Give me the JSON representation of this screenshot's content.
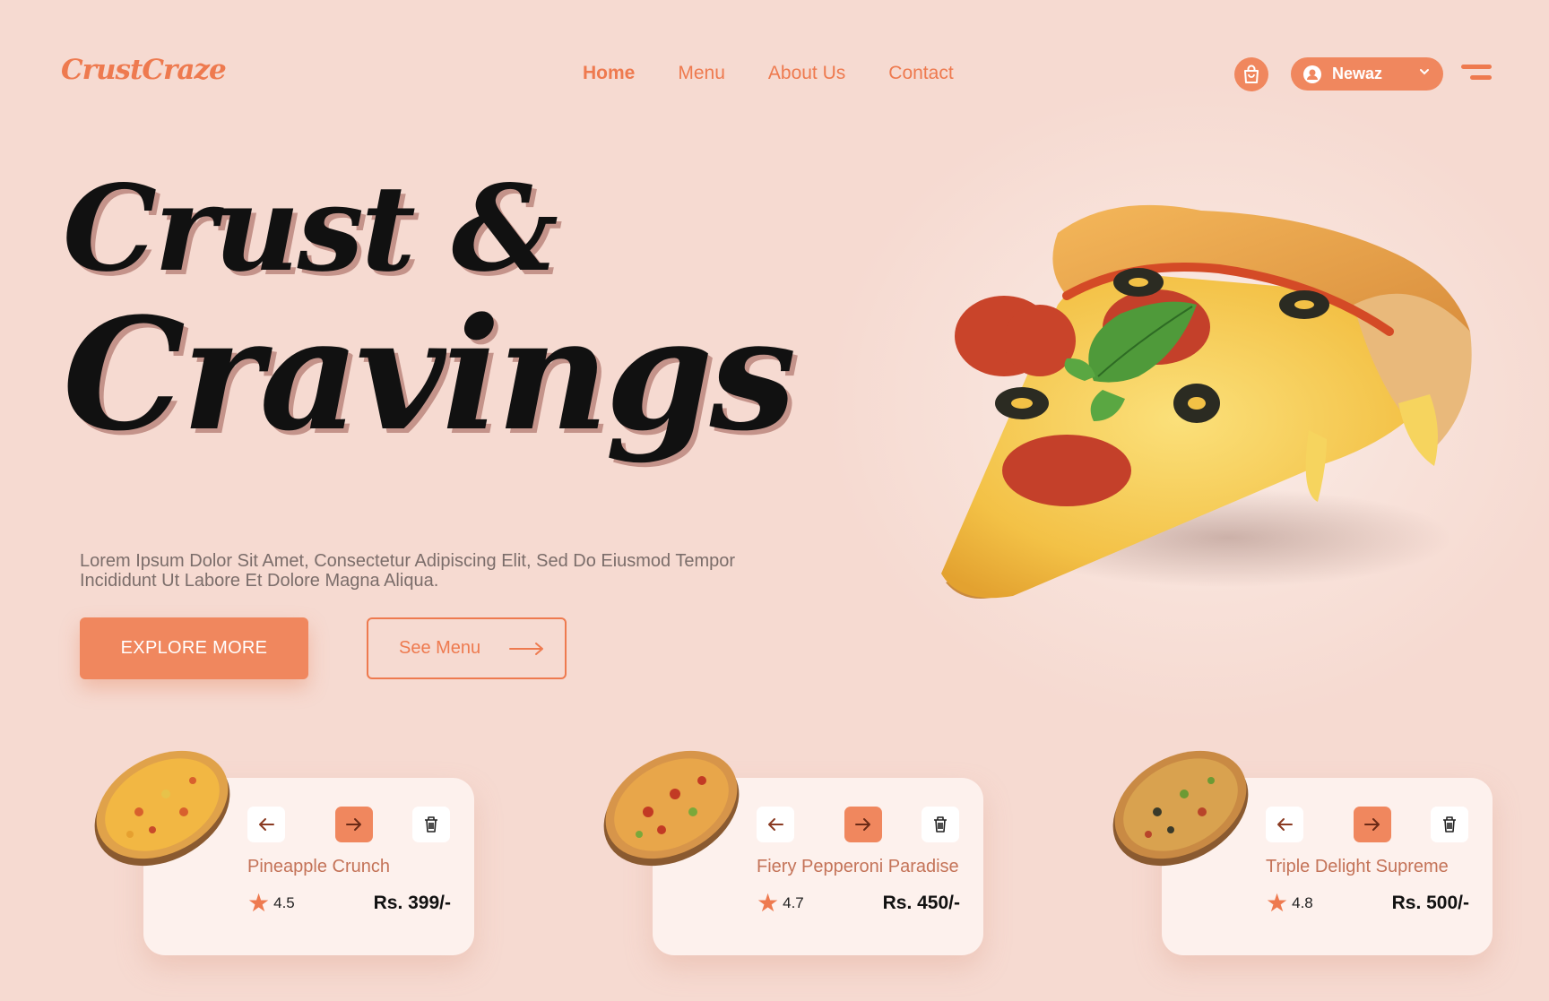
{
  "header": {
    "logo": "CrustCraze",
    "nav": [
      "Home",
      "Menu",
      "About Us",
      "Contact"
    ],
    "active_nav": "Home",
    "user_name": "Newaz",
    "icons": [
      "shopping-bag-icon",
      "user-icon",
      "chevron-down-icon",
      "hamburger-menu-icon"
    ]
  },
  "hero": {
    "title_line1": "Crust &",
    "title_line2": "Cravings",
    "description": "Lorem Ipsum Dolor Sit Amet, Consectetur Adipiscing Elit, Sed Do Eiusmod Tempor Incididunt Ut Labore Et Dolore Magna Aliqua.",
    "explore_label": "EXPLORE MORE",
    "see_menu_label": "See Menu"
  },
  "cards": [
    {
      "name": "Pineapple Crunch",
      "rating": "4.5",
      "price": "Rs. 399/-"
    },
    {
      "name": "Fiery Pepperoni Paradise",
      "rating": "4.7",
      "price": "Rs. 450/-"
    },
    {
      "name": "Triple Delight Supreme",
      "rating": "4.8",
      "price": "Rs. 500/-"
    }
  ],
  "colors": {
    "background": "#f6dad1",
    "accent": "#f0875e",
    "card": "#fdf1ed",
    "title": "#111111",
    "product_name": "#c47358"
  }
}
